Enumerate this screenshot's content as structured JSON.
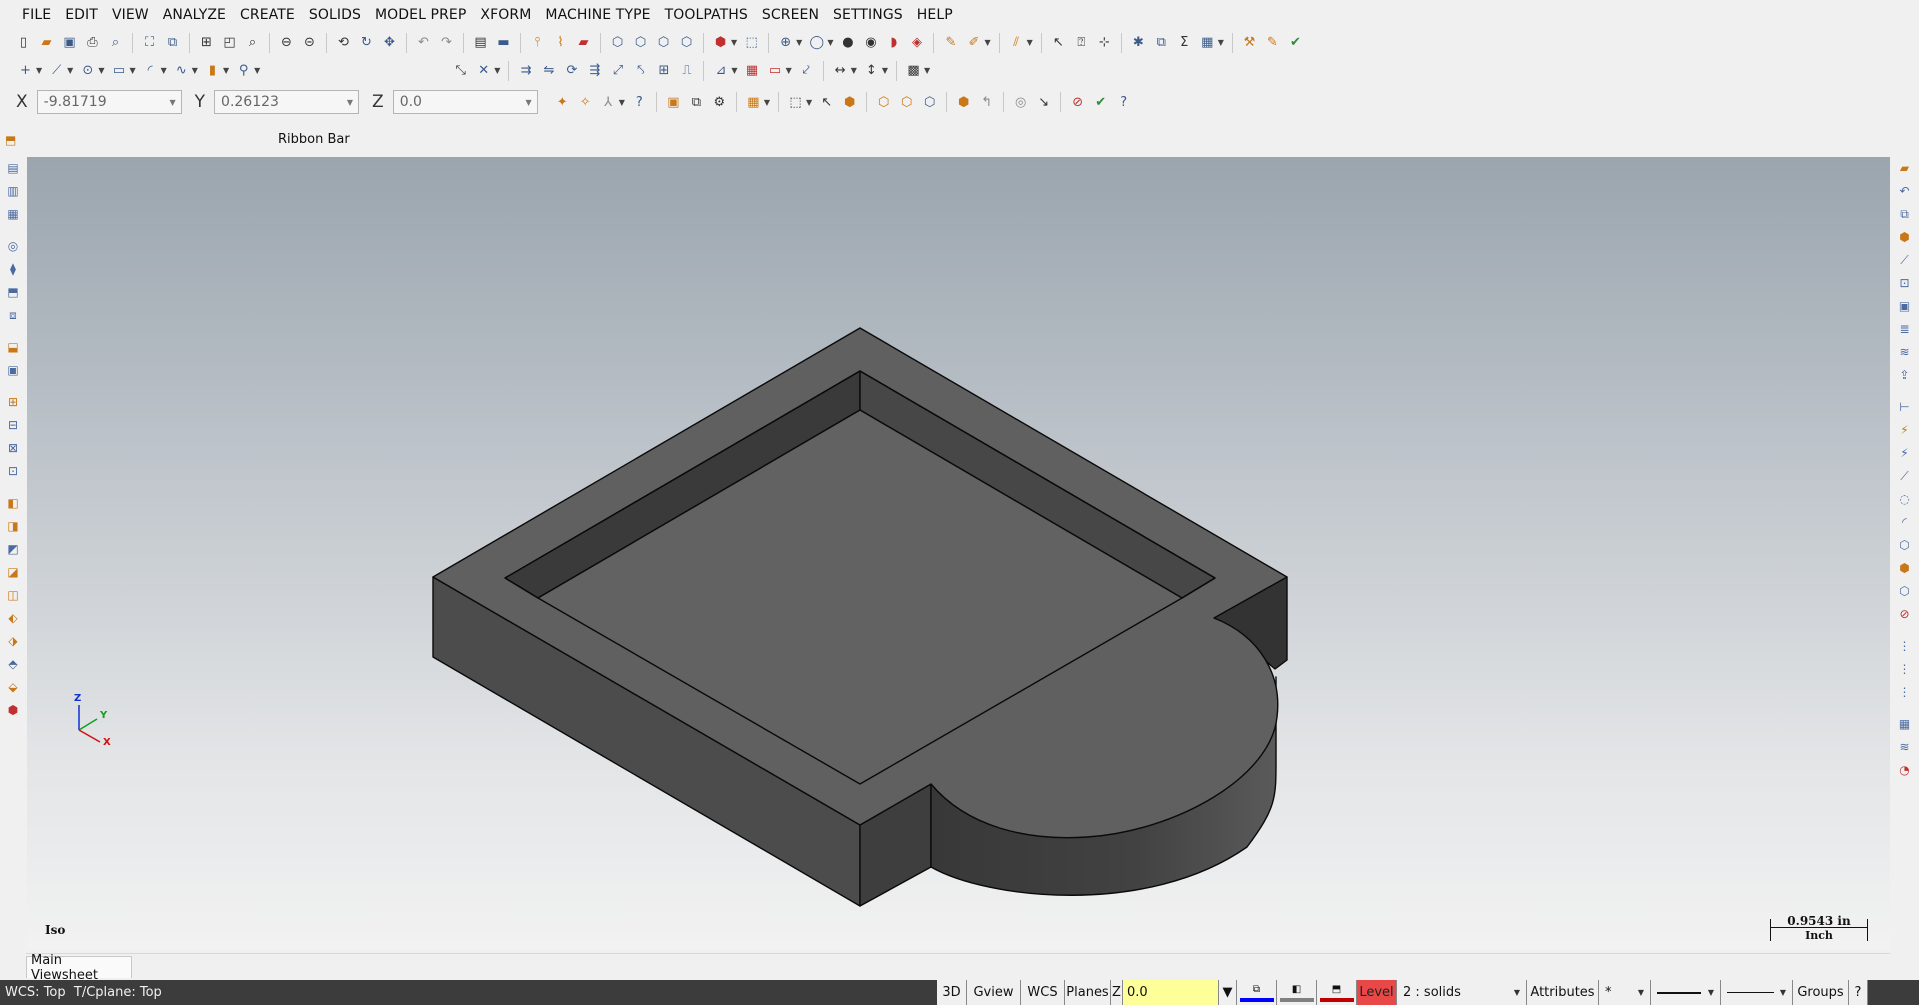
{
  "menu": [
    "FILE",
    "EDIT",
    "VIEW",
    "ANALYZE",
    "CREATE",
    "SOLIDS",
    "MODEL PREP",
    "XFORM",
    "MACHINE TYPE",
    "TOOLPATHS",
    "SCREEN",
    "SETTINGS",
    "HELP"
  ],
  "coords": {
    "x_label": "X",
    "x_value": "-9.81719",
    "y_label": "Y",
    "y_value": "0.26123",
    "z_label": "Z",
    "z_value": "0.0"
  },
  "ribbon": {
    "label": "Ribbon Bar"
  },
  "viewport": {
    "view_name": "Iso",
    "scale_value": "0.9543 in",
    "scale_unit": "Inch",
    "triad": {
      "z": "Z",
      "y": "Y",
      "x": "X"
    },
    "colors": {
      "part_top": "#606060",
      "part_side_left": "#4c4c4c",
      "part_side_right": "#3e3e3e",
      "edge": "#0a0a0a"
    }
  },
  "viewsheet": {
    "tab_label": "Main Viewsheet"
  },
  "status": {
    "left_text": "WCS: Top  T/Cplane: Top",
    "btn_3d": "3D",
    "btn_gview": "Gview",
    "btn_wcs": "WCS",
    "btn_planes": "Planes",
    "z_label": "Z",
    "z_value": "0.0",
    "level_label": "Level",
    "level_value": "2 : solids",
    "attributes": "Attributes",
    "point_style": "*",
    "groups": "Groups",
    "help": "?",
    "colors": {
      "wire": "#0000ff",
      "surface": "#808080",
      "solid": "#c00000"
    }
  }
}
